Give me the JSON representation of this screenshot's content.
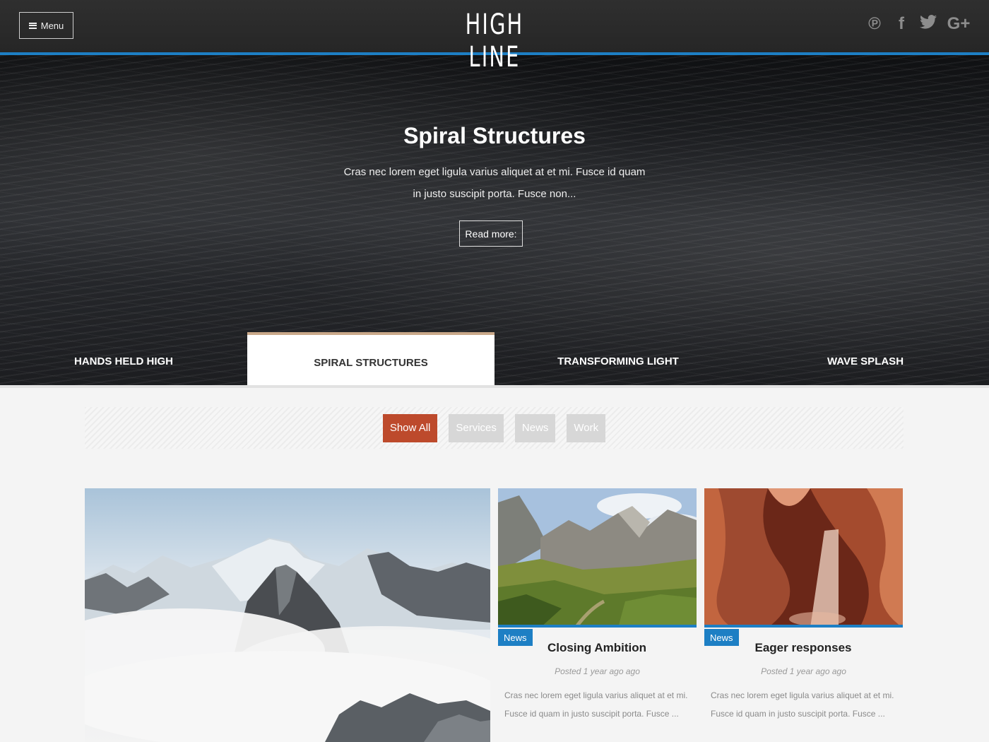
{
  "header": {
    "menu_label": "Menu",
    "logo": "HIGH LINE",
    "social": [
      {
        "icon": "pinterest-icon",
        "glyph": "℗"
      },
      {
        "icon": "facebook-icon",
        "glyph": "f"
      },
      {
        "icon": "twitter-icon",
        "glyph": "🐦"
      },
      {
        "icon": "google-plus-icon",
        "glyph": "G+"
      }
    ],
    "accent_color": "#1d7fc4"
  },
  "hero": {
    "title": "Spiral Structures",
    "text": "Cras nec lorem eget ligula varius aliquet at et mi. Fusce id quam in justo suscipit porta. Fusce non...",
    "read_more": "Read more:"
  },
  "slider_tabs": [
    {
      "label": "HANDS HELD HIGH",
      "active": false
    },
    {
      "label": "SPIRAL STRUCTURES",
      "active": true
    },
    {
      "label": "TRANSFORMING LIGHT",
      "active": false
    },
    {
      "label": "WAVE SPLASH",
      "active": false
    }
  ],
  "filters": [
    {
      "label": "Show All",
      "active": true
    },
    {
      "label": "Services",
      "active": false
    },
    {
      "label": "News",
      "active": false
    },
    {
      "label": "Work",
      "active": false
    }
  ],
  "filter_active_color": "#bd4a2c",
  "posts": [
    {
      "category": "News",
      "title": "Closing Ambition",
      "meta": "Posted 1 year ago ago",
      "excerpt": "Cras nec lorem eget ligula varius aliquet at et mi. Fusce id quam in justo suscipit porta. Fusce ..."
    },
    {
      "category": "News",
      "title": "Eager responses",
      "meta": "Posted 1 year ago ago",
      "excerpt": "Cras nec lorem eget ligula varius aliquet at et mi. Fusce id quam in justo suscipit porta. Fusce ..."
    }
  ]
}
